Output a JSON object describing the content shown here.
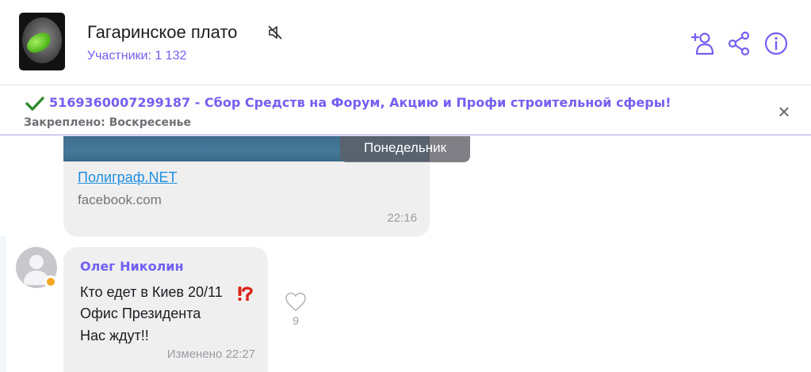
{
  "header": {
    "title": "Гагаринское плато",
    "participants": "Участники: 1 132",
    "icons": [
      "mute-icon",
      "add-user-icon",
      "share-icon",
      "info-icon"
    ]
  },
  "pinned": {
    "text": "5169360007299187 - Сбор Средств на Форум, Акцию и Профи строительной сферы!",
    "meta": "Закреплено: Воскресенье",
    "close_label": "×",
    "check_icon": "check-mark-icon"
  },
  "date_chip": "Понедельник",
  "link_message": {
    "title": "Полиграф.NET",
    "domain": "facebook.com",
    "time": "22:16"
  },
  "message": {
    "sender": "Олег Николин",
    "lines": [
      "Кто едет в Киев 20/11",
      "Офис Президента",
      "Нас ждут!!"
    ],
    "time": "Изменено 22:27",
    "likes": "9",
    "emoji": "exclamation-question-icon"
  },
  "colors": {
    "accent": "#7360f2",
    "link": "#1f8fde",
    "bubble": "#efeff0",
    "status": "#f5a623"
  }
}
